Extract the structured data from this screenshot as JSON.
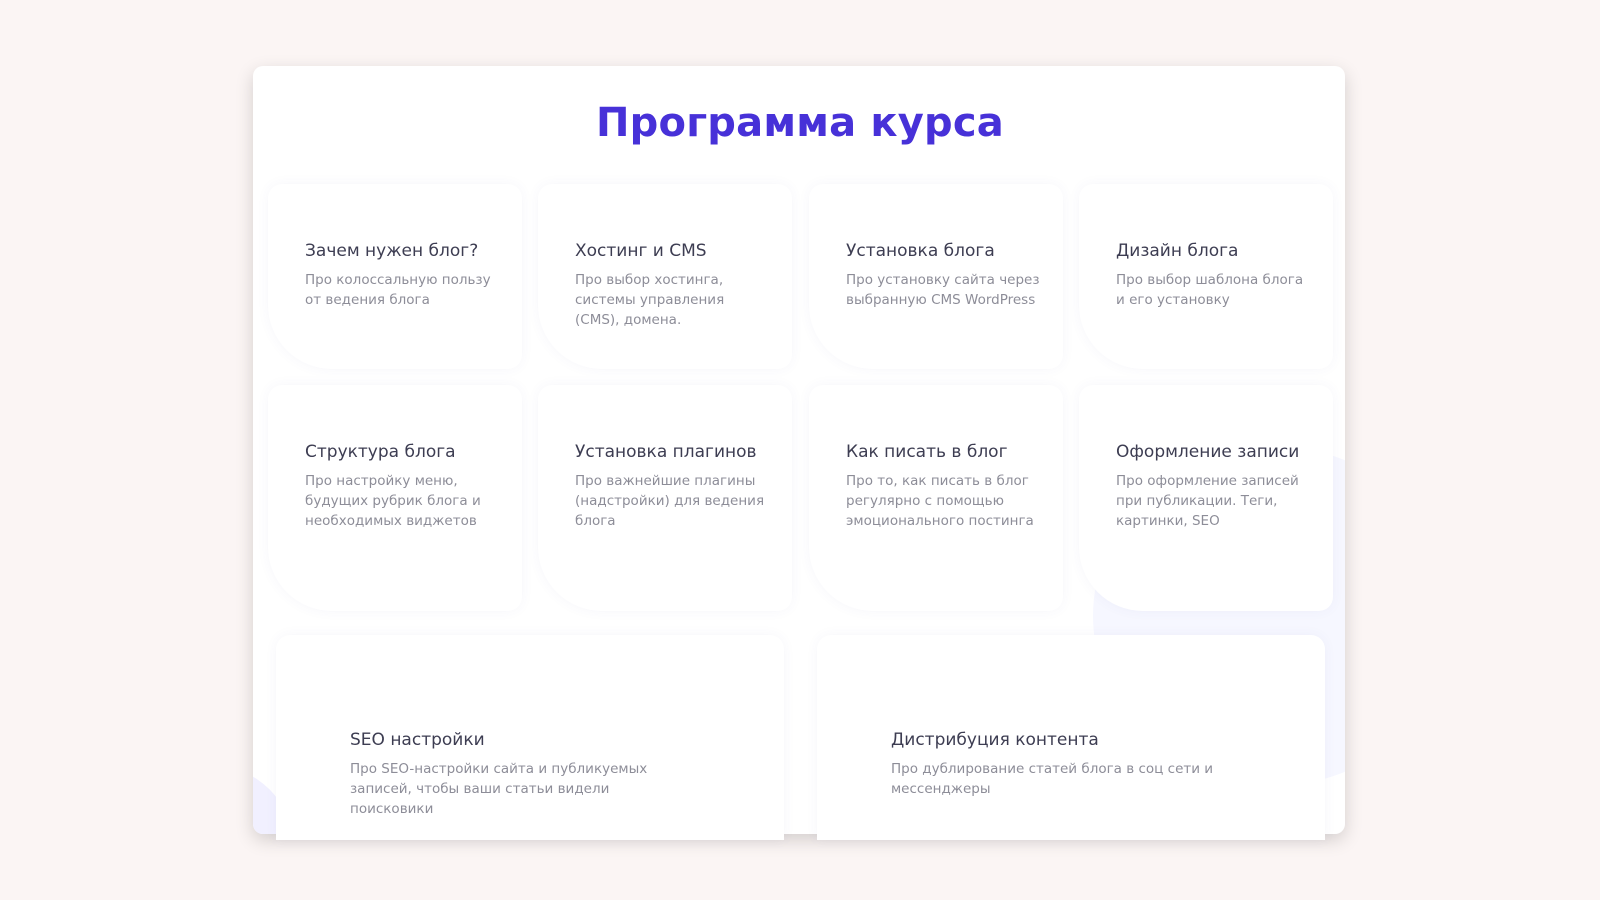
{
  "page": {
    "title": "Программа курса"
  },
  "colors": {
    "background": "#fbf5f4",
    "panel": "#ffffff",
    "title": "#4731d8",
    "card_title": "#3d3d52",
    "card_text": "#8d8d98"
  },
  "modules": [
    {
      "title": "Зачем нужен блог?",
      "text": "Про колоссальную пользу от ведения блога"
    },
    {
      "title": "Хостинг и CMS",
      "text": "Про выбор хостинга, системы управления (CMS), домена."
    },
    {
      "title": "Установка блога",
      "text": "Про установку сайта через выбранную CMS WordPress"
    },
    {
      "title": "Дизайн блога",
      "text": "Про выбор шаблона блога и его установку"
    },
    {
      "title": "Структура блога",
      "text": "Про настройку меню, будущих рубрик блога и необходимых виджетов"
    },
    {
      "title": "Установка плагинов",
      "text": "Про важнейшие плагины (надстройки) для ведения блога"
    },
    {
      "title": "Как писать в блог",
      "text": "Про то, как писать в блог регулярно с помощью эмоционального постинга"
    },
    {
      "title": "Оформление записи",
      "text": "Про оформление записей при публикации. Теги, картинки, SEO"
    },
    {
      "title": "SEO настройки",
      "text": "Про SEO-настройки сайта и публикуемых записей, чтобы ваши статьи видели поисковики"
    },
    {
      "title": "Дистрибуция контента",
      "text": "Про дублирование статей блога в соц сети и мессенджеры"
    }
  ]
}
